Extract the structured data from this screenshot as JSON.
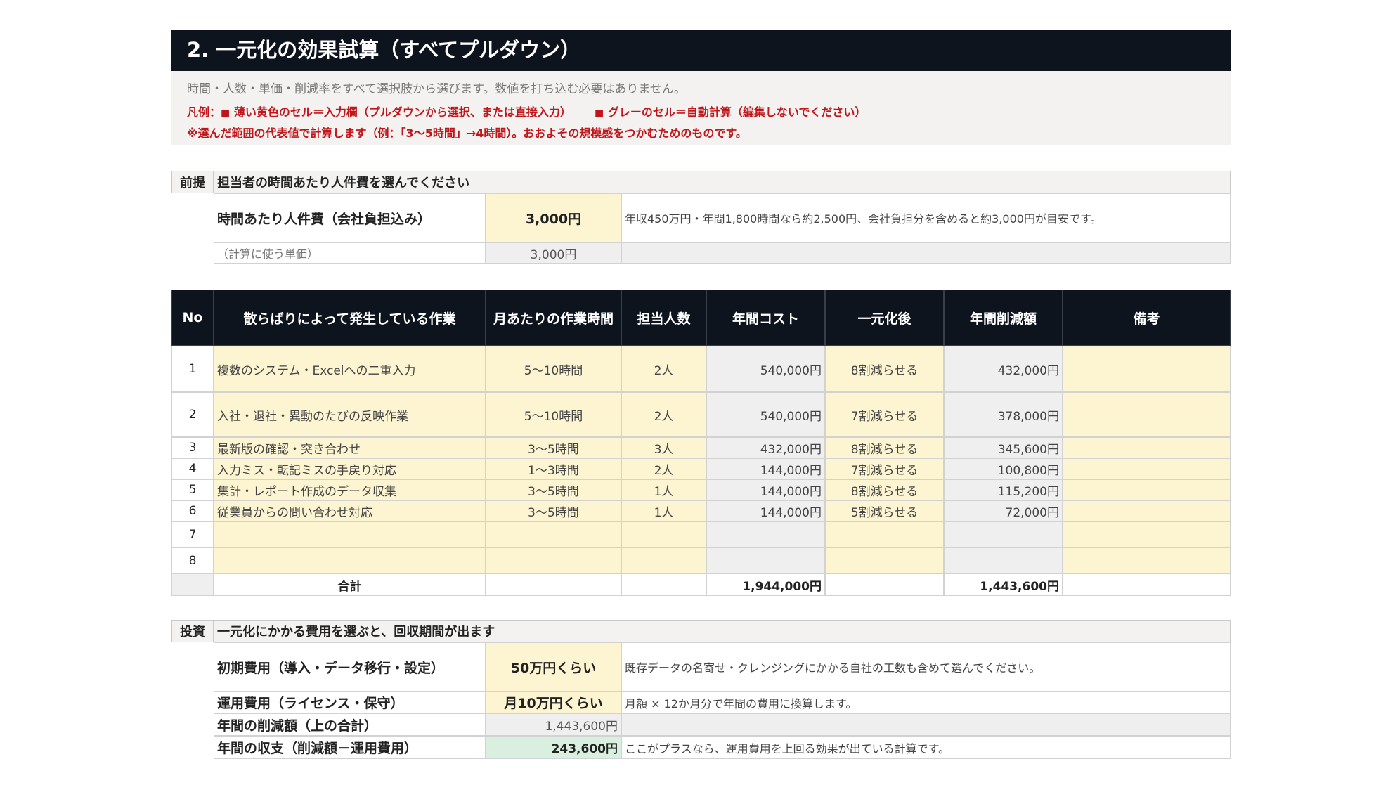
{
  "title": "2. 一元化の効果試算（すべてプルダウン）",
  "notes": {
    "subtitle": "時間・人数・単価・削減率をすべて選択肢から選びます。数値を打ち込む必要はありません。",
    "legend_prefix": "凡例：",
    "legend_yellow": "薄い黄色のセル＝入力欄（プルダウンから選択、または直接入力）",
    "legend_gray": "グレーのセル＝自動計算（編集しないでください）",
    "legend_square": "■",
    "disclaimer": "※選んだ範囲の代表値で計算します（例：「3〜5時間」→4時間）。おおよその規模感をつかむためのものです。"
  },
  "premise": {
    "tag": "前提",
    "heading": "担当者の時間あたり人件費を選んでください",
    "rate_label": "時間あたり人件費（会社負担込み）",
    "rate_value": "3,000円",
    "rate_note": "年収450万円・年間1,800時間なら約2,500円、会社負担分を含めると約3,000円が目安です。",
    "calc_label": "（計算に使う単価）",
    "calc_value": "3,000円"
  },
  "table": {
    "headers": [
      "No",
      "散らばりによって発生している作業",
      "月あたりの作業時間",
      "担当人数",
      "年間コスト",
      "一元化後",
      "年間削減額",
      "備考"
    ],
    "rows": [
      {
        "no": "1",
        "task": "複数のシステム・Excelへの二重入力",
        "hours": "5〜10時間",
        "people": "2人",
        "cost": "540,000円",
        "after": "8割減らせる",
        "saving": "432,000円",
        "memo": ""
      },
      {
        "no": "2",
        "task": "入社・退社・異動のたびの反映作業",
        "hours": "5〜10時間",
        "people": "2人",
        "cost": "540,000円",
        "after": "7割減らせる",
        "saving": "378,000円",
        "memo": ""
      },
      {
        "no": "3",
        "task": "最新版の確認・突き合わせ",
        "hours": "3〜5時間",
        "people": "3人",
        "cost": "432,000円",
        "after": "8割減らせる",
        "saving": "345,600円",
        "memo": ""
      },
      {
        "no": "4",
        "task": "入力ミス・転記ミスの手戻り対応",
        "hours": "1〜3時間",
        "people": "2人",
        "cost": "144,000円",
        "after": "7割減らせる",
        "saving": "100,800円",
        "memo": ""
      },
      {
        "no": "5",
        "task": "集計・レポート作成のデータ収集",
        "hours": "3〜5時間",
        "people": "1人",
        "cost": "144,000円",
        "after": "8割減らせる",
        "saving": "115,200円",
        "memo": ""
      },
      {
        "no": "6",
        "task": "従業員からの問い合わせ対応",
        "hours": "3〜5時間",
        "people": "1人",
        "cost": "144,000円",
        "after": "5割減らせる",
        "saving": "72,000円",
        "memo": ""
      },
      {
        "no": "7",
        "task": "",
        "hours": "",
        "people": "",
        "cost": "",
        "after": "",
        "saving": "",
        "memo": ""
      },
      {
        "no": "8",
        "task": "",
        "hours": "",
        "people": "",
        "cost": "",
        "after": "",
        "saving": "",
        "memo": ""
      }
    ],
    "total_label": "合計",
    "total_cost": "1,944,000円",
    "total_saving": "1,443,600円"
  },
  "investment": {
    "tag": "投資",
    "heading": "一元化にかかる費用を選ぶと、回収期間が出ます",
    "initial_label": "初期費用（導入・データ移行・設定）",
    "initial_value": "50万円くらい",
    "initial_note": "既存データの名寄せ・クレンジングにかかる自社の工数も含めて選んでください。",
    "running_label": "運用費用（ライセンス・保守）",
    "running_value": "月10万円くらい",
    "running_note": "月額 × 12か月分で年間の費用に換算します。",
    "saving_label": "年間の削減額（上の合計）",
    "saving_value": "1,443,600円",
    "balance_label": "年間の収支（削減額－運用費用）",
    "balance_value": "243,600円",
    "balance_note": "ここがプラスなら、運用費用を上回る効果が出ている計算です。"
  }
}
